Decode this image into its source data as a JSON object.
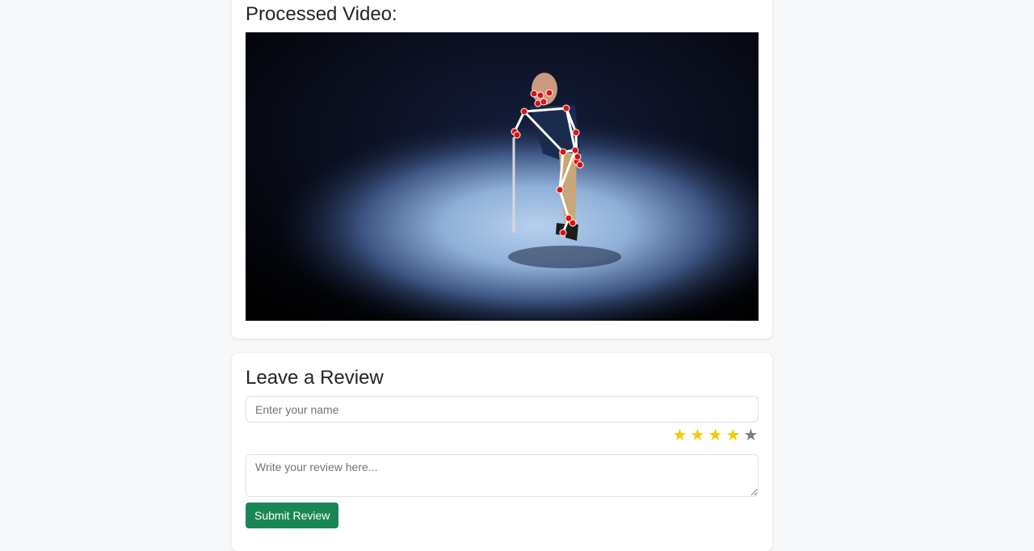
{
  "video_card": {
    "title": "Processed Video:",
    "video": {
      "description_icon": "pose-estimation-video-frame",
      "background_color": "#05070f",
      "spotlight_color": "#a9c4e6",
      "skeleton_line_color": "#ffffff",
      "keypoint_color": "#e01010"
    }
  },
  "review_card": {
    "title": "Leave a Review",
    "name_placeholder": "Enter your name",
    "rating": 4,
    "max_rating": 5,
    "star_icon": "star-icon",
    "star_on_color": "#f7c800",
    "star_off_color": "#7d7d7d",
    "review_placeholder": "Write your review here...",
    "submit_label": "Submit Review",
    "submit_color": "#198754"
  }
}
